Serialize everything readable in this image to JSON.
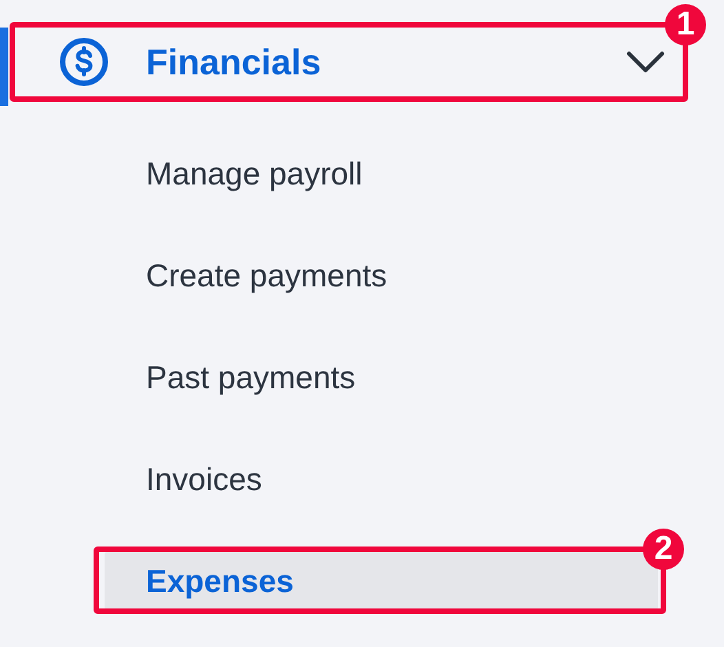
{
  "section": {
    "title": "Financials",
    "expanded": true,
    "selected": true,
    "annotation": "1"
  },
  "items": [
    {
      "label": "Manage payroll",
      "selected": false
    },
    {
      "label": "Create payments",
      "selected": false
    },
    {
      "label": "Past payments",
      "selected": false
    },
    {
      "label": "Invoices",
      "selected": false
    },
    {
      "label": "Expenses",
      "selected": true,
      "annotation": "2"
    }
  ]
}
